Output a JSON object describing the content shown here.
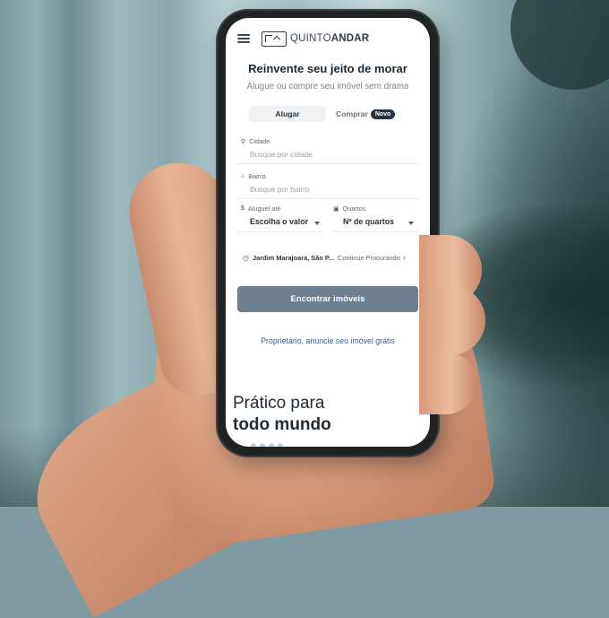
{
  "brand": {
    "name_light": "QUINTO",
    "name_bold": "ANDAR"
  },
  "hero": {
    "title": "Reinvente seu jeito de morar",
    "subtitle": "Alugue ou compre seu imóvel sem drama"
  },
  "tabs": {
    "rent": "Alugar",
    "buy": "Comprar",
    "new_badge": "Novo"
  },
  "form": {
    "city": {
      "label": "Cidade",
      "placeholder": "Busque por cidade",
      "icon": "location-pin-icon"
    },
    "neighborhood": {
      "label": "Bairro",
      "placeholder": "Busque por bairro",
      "icon": "house-icon"
    },
    "rent_up_to": {
      "label": "Aluguel até",
      "value": "Escolha o valor",
      "icon": "dollar-icon"
    },
    "bedrooms": {
      "label": "Quartos",
      "value": "Nº de quartos",
      "icon": "bed-icon"
    }
  },
  "recent_search": {
    "location": "Jardim Marajoara, São P...",
    "action": "Continue Procurando",
    "icon": "clock-icon"
  },
  "cta": {
    "find": "Encontrar imóveis"
  },
  "owner_link": "Proprietário, anuncie seu imóvel grátis",
  "promo": {
    "line1": "Prático para",
    "line2": "todo mundo"
  },
  "colors": {
    "primary_button": "#6e7f8e",
    "text_dark": "#1d2a33",
    "badge": "#2a3441"
  }
}
